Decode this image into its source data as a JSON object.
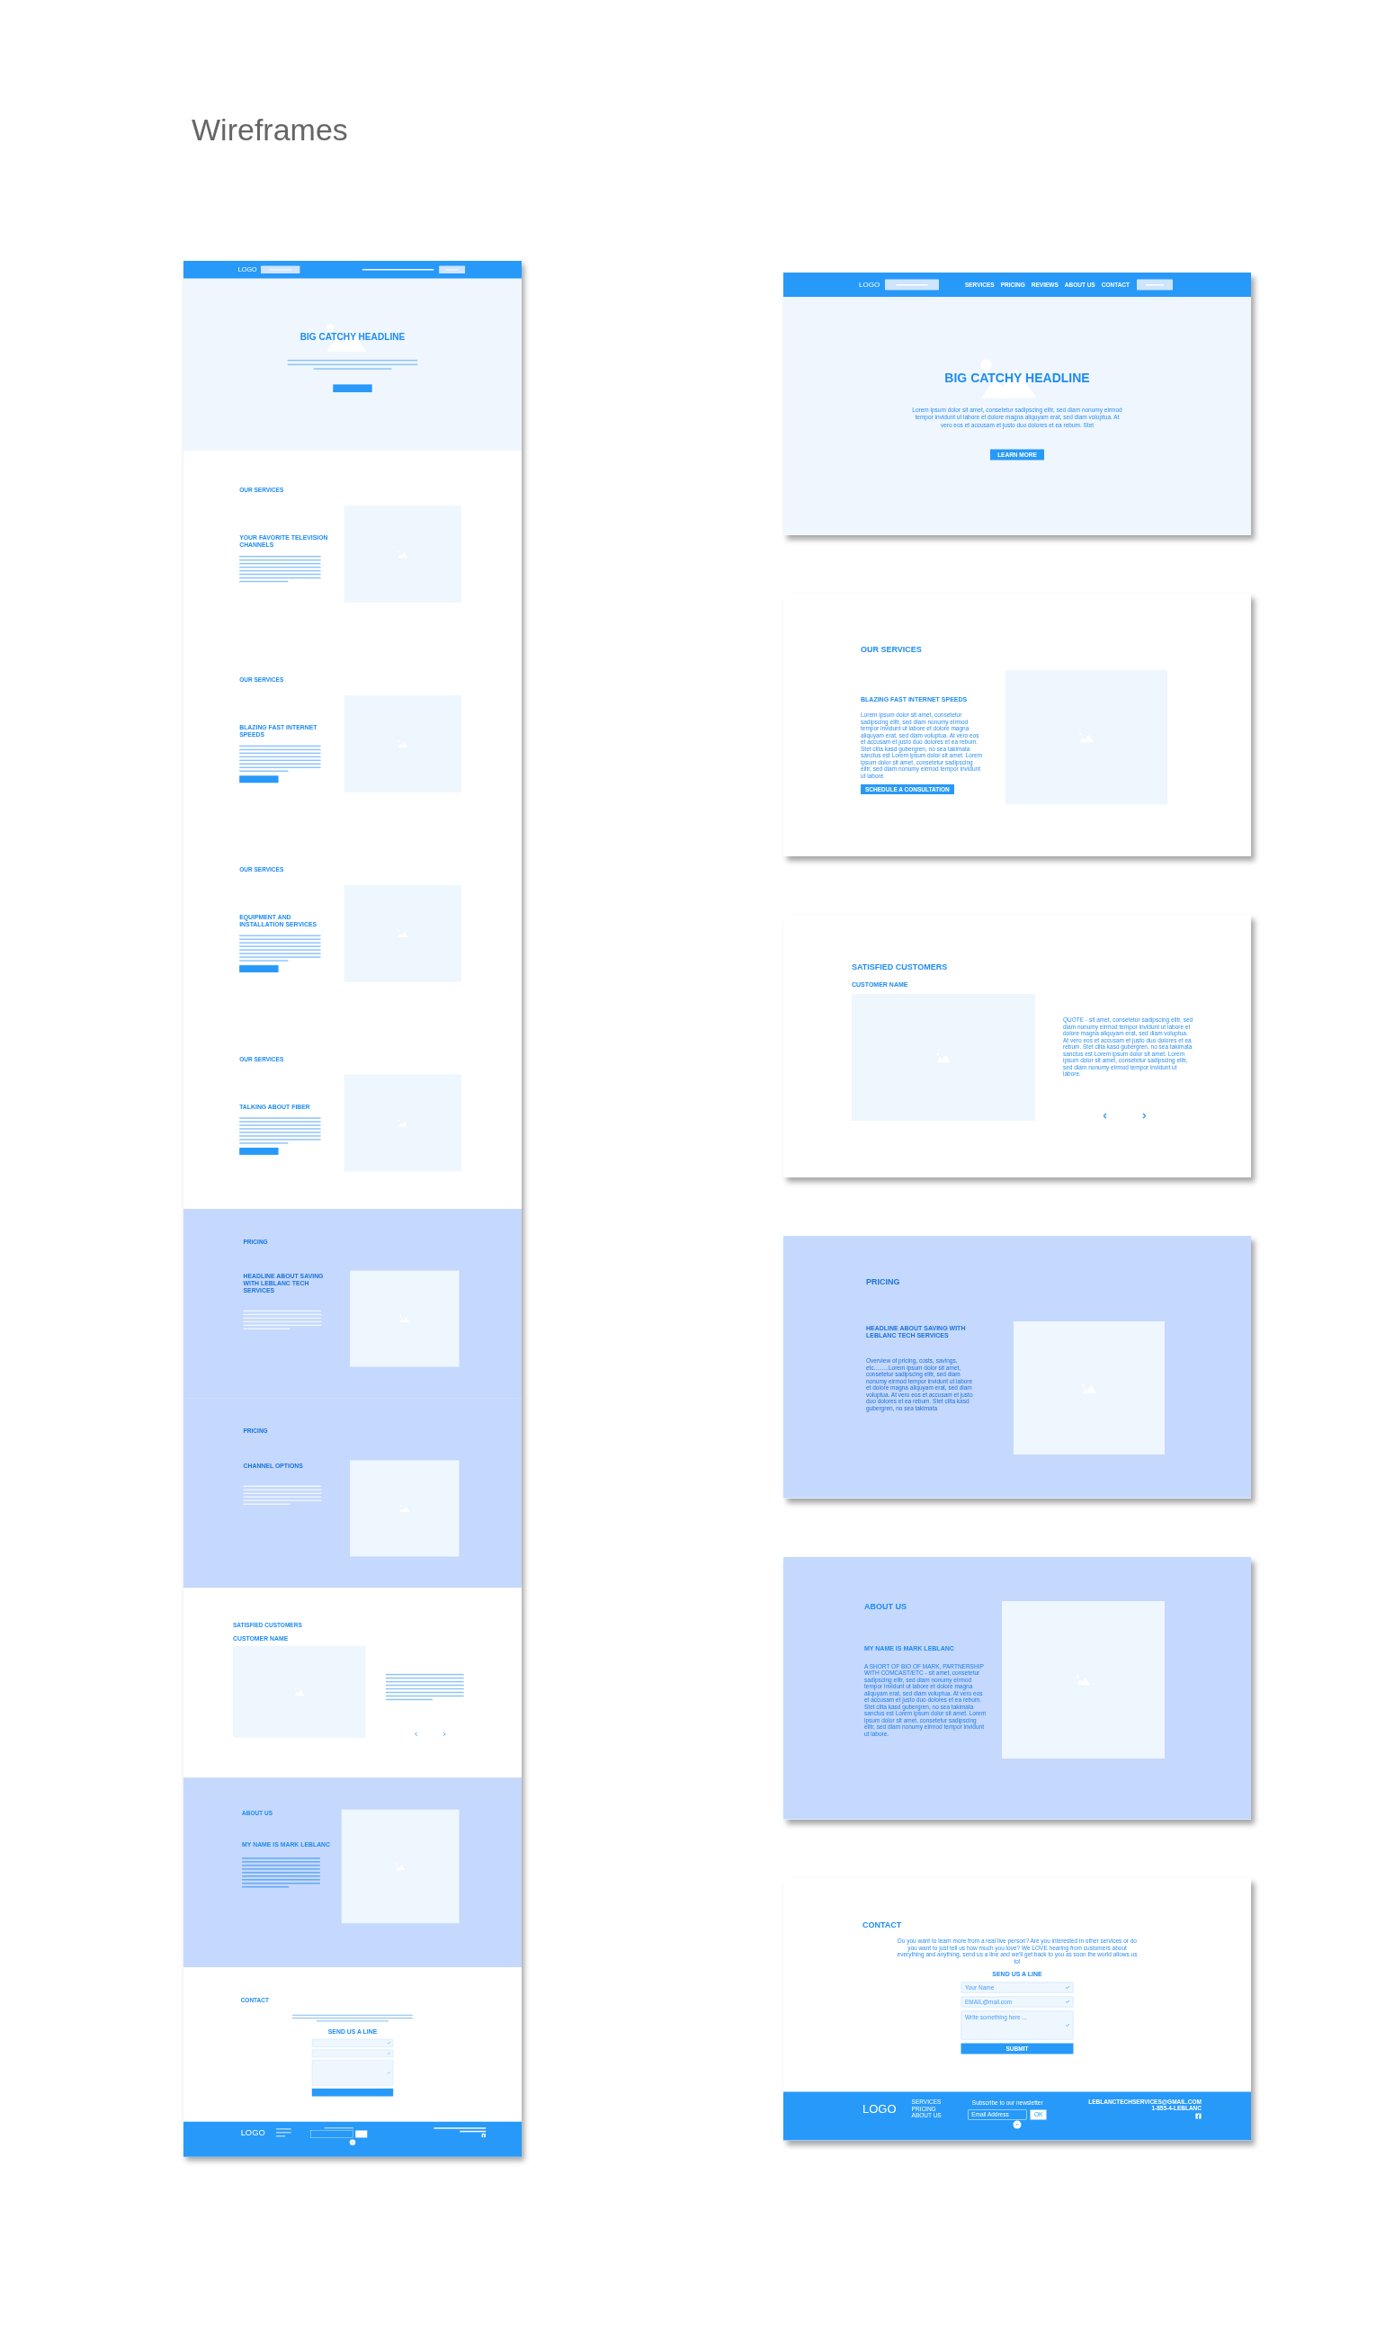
{
  "title": "Wireframes",
  "full_page": {
    "sections": [
      {
        "kind": "hero",
        "nav": {
          "logo": "LOGO"
        },
        "headline": "BIG CATCHY HEADLINE"
      },
      {
        "kind": "services",
        "title": "OUR SERVICES",
        "heading": "YOUR FAVORITE TELEVISION CHANNELS",
        "cta": false
      },
      {
        "kind": "services",
        "title": "OUR SERVICES",
        "heading": "BLAZING FAST INTERNET SPEEDS",
        "cta": true
      },
      {
        "kind": "services",
        "title": "OUR SERVICES",
        "heading": "EQUIPMENT AND INSTALLATION SERVICES",
        "cta": true
      },
      {
        "kind": "services",
        "title": "OUR SERVICES",
        "heading": "TALKING ABOUT FIBER",
        "cta": true
      },
      {
        "kind": "pricing",
        "title": "PRICING",
        "heading": "HEADLINE ABOUT SAVING WITH LEBLANC TECH SERVICES"
      },
      {
        "kind": "pricing",
        "title": "PRICING",
        "heading": "CHANNEL OPTIONS"
      },
      {
        "kind": "customers",
        "title": "SATISFIED CUSTOMERS",
        "name": "CUSTOMER NAME"
      },
      {
        "kind": "about",
        "title": "ABOUT US",
        "heading": "MY NAME IS MARK LEBLANC"
      },
      {
        "kind": "contact",
        "title": "CONTACT",
        "form_title": "SEND US A LINE",
        "fields": [
          {
            "kind": "input"
          },
          {
            "kind": "input"
          },
          {
            "kind": "textarea"
          }
        ],
        "footer": {
          "logo": "LOGO"
        }
      }
    ]
  },
  "frames": [
    {
      "kind": "hero",
      "nav": {
        "logo": "LOGO",
        "links": [
          "SERVICES",
          "PRICING",
          "REVIEWS",
          "ABOUT US",
          "CONTACT"
        ]
      },
      "headline": "BIG CATCHY HEADLINE",
      "text": "Lorem ipsum dolor sit amet, consetetur sadipscing elitr, sed diam nonumy eirmod tempor invidunt ut labore et dolore magna aliquyam erat, sed diam voluptua. At vero eos et accusam et justo duo dolores et ea rebum. Stet",
      "button": "LEARN MORE"
    },
    {
      "kind": "services",
      "title": "OUR SERVICES",
      "heading": "BLAZING FAST INTERNET SPEEDS",
      "text": "Lorem ipsum dolor sit amet, consetetur sadipscing elitr, sed diam nonumy eirmod tempor invidunt ut labore et dolore magna aliquyam erat, sed diam voluptua. At vero eos et accusam et justo duo dolores et ea rebum. Stet clita kasd gubergren, no sea takimata sanctus est Lorem ipsum dolor sit amet. Lorem ipsum dolor sit amet, consetetur sadipscing elitr, sed diam nonumy eirmod tempor invidunt ut labore.",
      "cta": true,
      "button": "SCHEDULE A CONSULTATION"
    },
    {
      "kind": "customers",
      "title": "SATISFIED CUSTOMERS",
      "name": "CUSTOMER NAME",
      "quote": "QUOTE - sit amet, consetetur sadipscing elitr, sed diam nonumy eirmod tempor invidunt ut labore et dolore magna aliquyam erat, sed diam voluptua. At vero eos et accusam et justo duo dolores et ea rebum. Stet clita kasd gubergren, no sea takimata sanctus est Lorem ipsum dolor sit amet. Lorem ipsum dolor sit amet, consetetur sadipscing elitr, sed diam nonumy eirmod tempor invidunt ut labore."
    },
    {
      "kind": "pricing",
      "title": "PRICING",
      "heading": "HEADLINE ABOUT SAVING WITH LEBLANC TECH SERVICES",
      "text": "Overview of pricing, costs, savings, etc.........Lorem ipsum dolor sit amet, consetetur sadipscing elitr, sed diam nonumy eirmod tempor invidunt ut labore et dolore magna aliquyam erat, sed diam voluptua. At vero eos et accusam et justo duo dolores et ea rebum. Stet clita kasd gubergren, no sea takimata"
    },
    {
      "kind": "about",
      "title": "ABOUT US",
      "heading": "MY NAME IS MARK LEBLANC",
      "text": "A SHORT OF BIO OF MARK, PARTNERSHIP WITH COMCAST/ETC - sit amet, consetetur sadipscing elitr, sed diam nonumy eirmod tempor invidunt ut labore et dolore magna aliquyam erat, sed diam voluptua. At vero eos et accusam et justo duo dolores et ea rebum. Stet clita kasd gubergren, no sea takimata sanctus est Lorem ipsum dolor sit amet. Lorem ipsum dolor sit amet, consetetur sadipscing elitr, sed diam nonumy eirmod tempor invidunt ut labore."
    },
    {
      "kind": "contact",
      "title": "CONTACT",
      "text": "Do you want to learn more from a real live person? Are you interested in other services or do you want to just tell us how much you love? We LOVE hearing from customers about everything and anything, send us a line and we'll get back to you as soon the world allows us to!",
      "form_title": "SEND US A LINE",
      "fields": [
        {
          "kind": "input",
          "placeholder": "Your Name"
        },
        {
          "kind": "input",
          "placeholder": "EMAIL@mail.com"
        },
        {
          "kind": "textarea",
          "placeholder": "Write something here ..."
        }
      ],
      "submit": "SUBMIT",
      "footer": {
        "logo": "LOGO",
        "links": [
          "SERVICES",
          "PRICING",
          "ABOUT US"
        ],
        "newsletter": "Subscribe to our newsletter",
        "email_placeholder": "Email Address",
        "ok": "OK",
        "email": "LEBLANCTECHSERVICES@GMAIL.COM",
        "phone": "1-855-4-LEBLANC"
      }
    }
  ]
}
